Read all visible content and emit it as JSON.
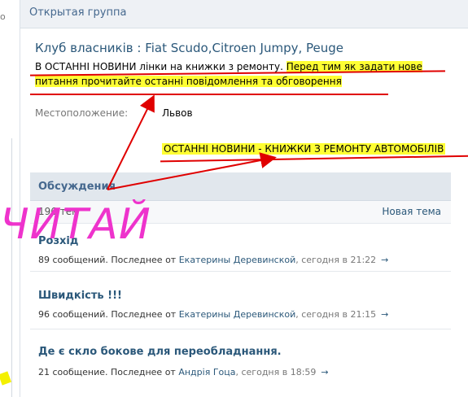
{
  "left_edge": {
    "mark": "o"
  },
  "header": {
    "title": "Открытая группа"
  },
  "group": {
    "title": "Клуб власників : Fiat Scudo,Citroen Jumpy, Peuge",
    "news_plain": "В ОСТАННІ НОВИНИ лінки на книжки з ремонту. ",
    "news_highlight_1": "Перед тим як задати нове",
    "news_highlight_2": "питання прочитайте останні повідомлення та обговорення"
  },
  "location": {
    "label": "Местоположение:",
    "value": "Львов"
  },
  "callout": {
    "text": "ОСТАННІ НОВИНИ - КНИЖКИ З РЕМОНТУ АВТОМОБІЛІВ"
  },
  "discussions": {
    "header": "Обсуждения",
    "count": "196 тем",
    "new_topic": "Новая тема",
    "topics": [
      {
        "title": "Розхід",
        "count_text": "89 сообщений. Последнее от",
        "author": "Екатерины Деревинской",
        "time": ", сегодня в 21:22",
        "arrow": "→"
      },
      {
        "title": "Швидкість !!!",
        "count_text": "96 сообщений. Последнее от",
        "author": "Екатерины Деревинской",
        "time": ", сегодня в 21:15",
        "arrow": "→"
      },
      {
        "title": "Де є скло бокове для переобладнання.",
        "count_text": "21 сообщение. Последнее от",
        "author": "Андрія Гоца",
        "time": ", сегодня в 18:59",
        "arrow": "→"
      }
    ]
  },
  "annotation": {
    "text": "ЧИТАЙ",
    "color": "#ee33cc",
    "arrow_color": "#e00000",
    "highlight_color": "#ffff33"
  },
  "colors": {
    "link": "#2b587a",
    "header_bg": "#eef1f5",
    "section_bg": "#e1e7ed"
  }
}
